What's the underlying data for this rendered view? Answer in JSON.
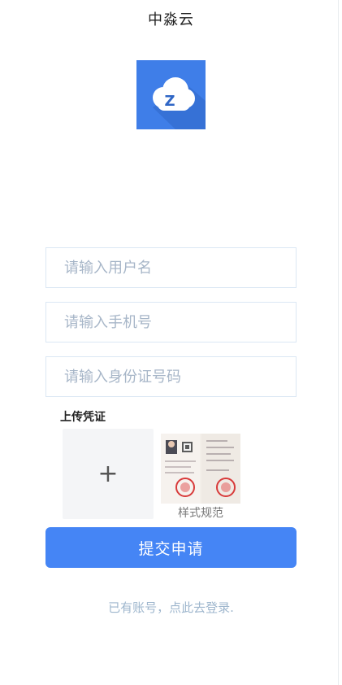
{
  "header": {
    "title": "中淼云"
  },
  "logo": {
    "letter": "Z",
    "icon": "cloud-icon",
    "color": "#3f7ee8"
  },
  "form": {
    "username_placeholder": "请输入用户名",
    "phone_placeholder": "请输入手机号",
    "idcard_placeholder": "请输入身份证号码",
    "upload_label": "上传凭证",
    "upload_icon": "plus-icon",
    "upload_plus": "+",
    "sample_caption": "样式规范",
    "submit_label": "提交申请",
    "login_link": "已有账号，点此去登录."
  },
  "colors": {
    "primary": "#4585f5",
    "link": "#9eb6cd",
    "placeholder": "#a7b6c8"
  }
}
